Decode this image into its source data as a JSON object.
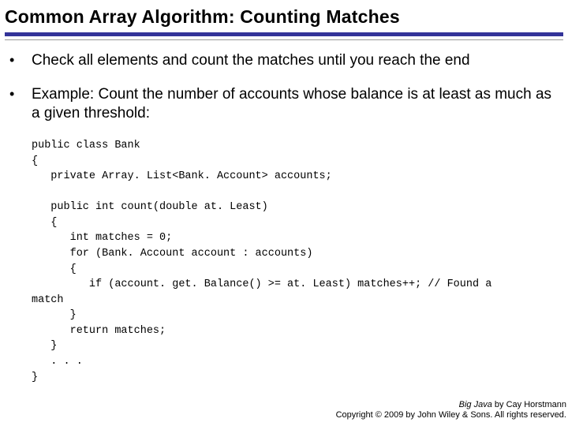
{
  "title": "Common Array Algorithm: Counting Matches",
  "bullets": {
    "b1": "Check all elements and count the matches until you reach the end",
    "b2": "Example: Count the number of accounts whose balance is at least as much as a given threshold:"
  },
  "code": "public class Bank\n{\n   private Array. List<Bank. Account> accounts;\n\n   public int count(double at. Least)\n   {\n      int matches = 0;\n      for (Bank. Account account : accounts)\n      {\n         if (account. get. Balance() >= at. Least) matches++; // Found a\nmatch\n      }\n      return matches;\n   }\n   . . .\n}",
  "footer": {
    "book_title": "Big Java",
    "byline": " by Cay Horstmann",
    "copyright": "Copyright © 2009 by John Wiley & Sons. All rights reserved."
  }
}
